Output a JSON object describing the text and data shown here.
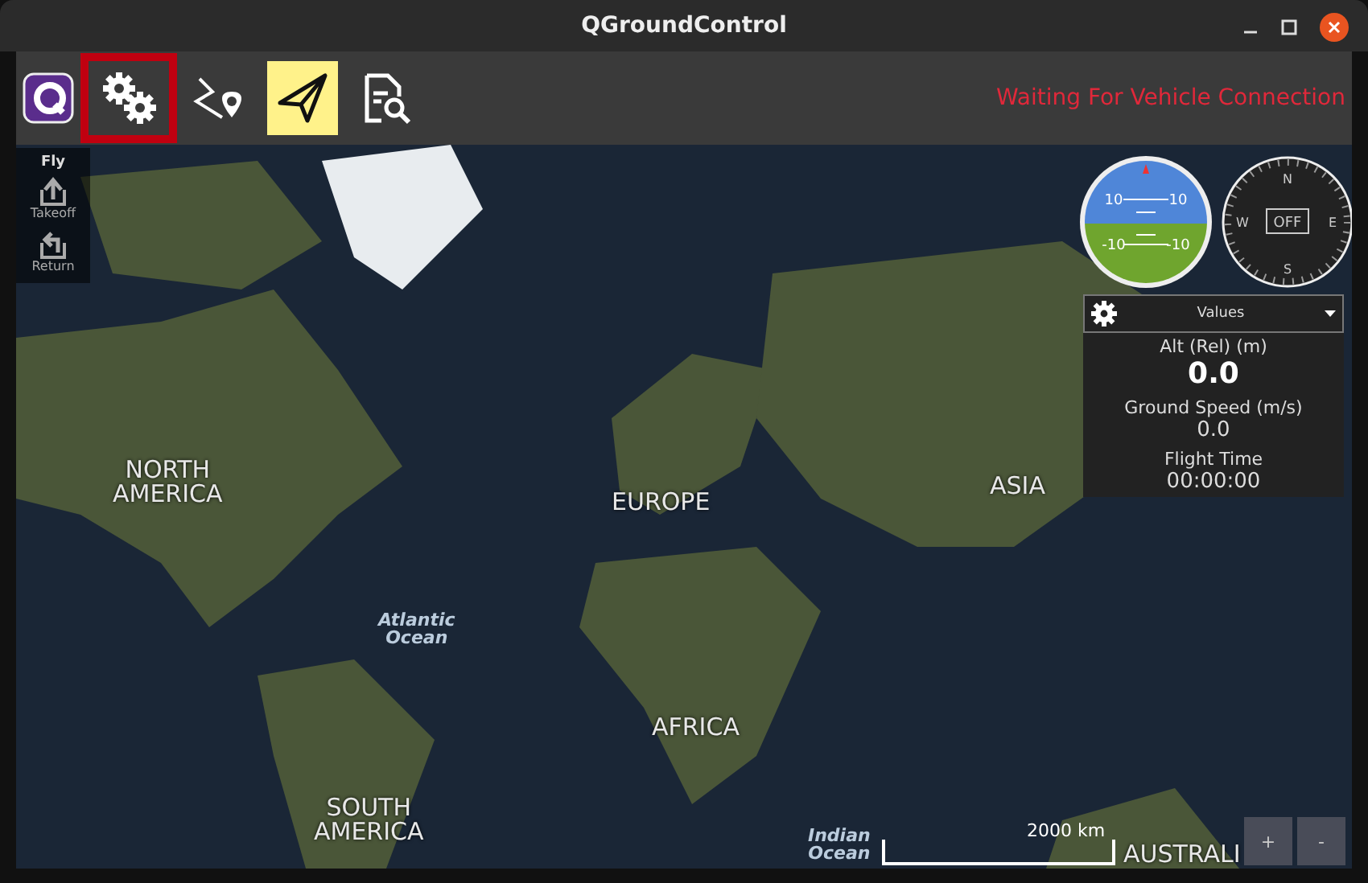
{
  "window": {
    "title": "QGroundControl"
  },
  "toolbar": {
    "tools": [
      {
        "kind": "gear",
        "selected": false,
        "highlighted": true
      },
      {
        "kind": "route",
        "selected": false,
        "highlighted": false
      },
      {
        "kind": "plane",
        "selected": true,
        "highlighted": false
      },
      {
        "kind": "doc",
        "selected": false,
        "highlighted": false
      }
    ],
    "status": "Waiting For Vehicle Connection"
  },
  "fly_panel": {
    "title": "Fly",
    "actions": [
      {
        "kind": "takeoff",
        "label": "Takeoff"
      },
      {
        "kind": "return",
        "label": "Return"
      }
    ]
  },
  "attitude": {
    "labels": [
      "10",
      "10",
      "-10",
      "-10"
    ]
  },
  "compass": {
    "labels": [
      "N",
      "W",
      "E",
      "S"
    ],
    "center": "OFF"
  },
  "values_panel": {
    "header": "Values",
    "items": [
      {
        "label": "Alt (Rel) (m)",
        "value": "0.0",
        "large": true
      },
      {
        "label": "Ground Speed (m/s)",
        "value": "0.0",
        "large": false
      },
      {
        "label": "Flight Time",
        "value": "00:00:00",
        "large": false
      }
    ]
  },
  "map": {
    "labels": [
      {
        "kind": "continent",
        "text": "NORTH AMERICA"
      },
      {
        "kind": "continent",
        "text": "EUROPE"
      },
      {
        "kind": "continent",
        "text": "ASIA"
      },
      {
        "kind": "ocean",
        "text": "Atlantic Ocean"
      },
      {
        "kind": "continent",
        "text": "AFRICA"
      },
      {
        "kind": "continent",
        "text": "SOUTH AMERICA"
      },
      {
        "kind": "ocean",
        "text": "Indian Ocean"
      },
      {
        "kind": "continent",
        "text": "AUSTRALI"
      }
    ],
    "scale": "2000 km",
    "zoom_buttons": [
      "+",
      "-"
    ]
  }
}
